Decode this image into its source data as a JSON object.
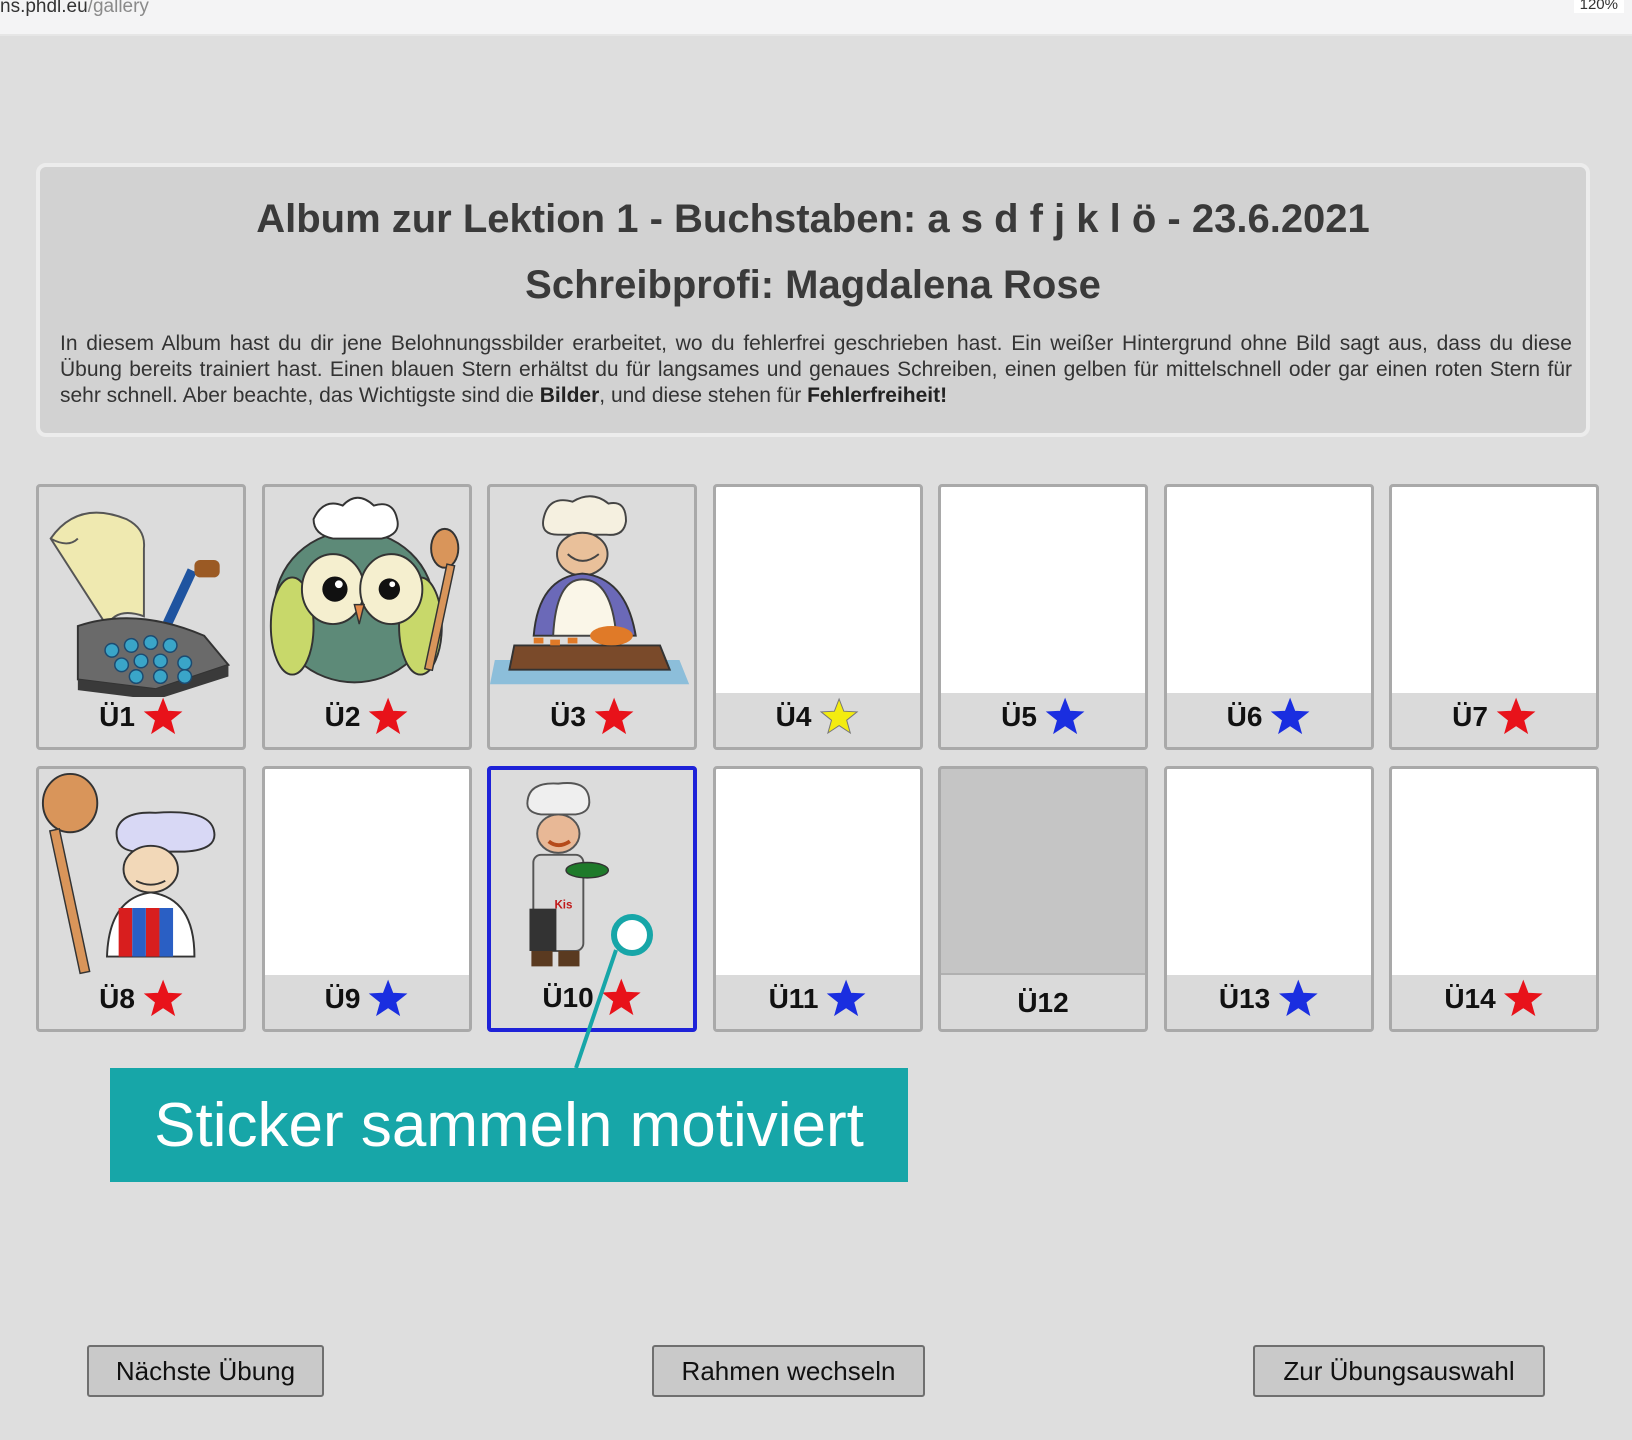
{
  "browser": {
    "url_host": "ns.phdl.eu",
    "url_path": "/gallery",
    "zoom": "120%"
  },
  "album": {
    "title": "Album zur Lektion 1 - Buchstaben: a s d f j k l ö - 23.6.2021",
    "subtitle": "Schreibprofi: Magdalena Rose",
    "intro_1": "In diesem Album hast du dir jene Belohnungssbilder erarbeitet, wo du fehlerfrei geschrieben hast. Ein weißer Hintergrund ohne Bild sagt aus, dass du diese Übung bereits trainiert hast. Einen blauen Stern erhältst du für langsames und genaues Schreiben, einen gelben für mittelschnell oder gar einen roten Stern für sehr schnell. Aber beachte, das Wichtigste sind die ",
    "intro_bold_1": "Bilder",
    "intro_2": ", und diese stehen für ",
    "intro_bold_2": "Fehlerfreiheit!"
  },
  "colors": {
    "red_star": "#e8121a",
    "blue_star": "#1a2ee0",
    "yellow_star": "#f4ec10",
    "selected_border": "#1e22d8",
    "callout": "#17a6a8"
  },
  "tiles": [
    {
      "label": "Ü1",
      "star": "red",
      "picture": "typewriter"
    },
    {
      "label": "Ü2",
      "star": "red",
      "picture": "owl-chef"
    },
    {
      "label": "Ü3",
      "star": "red",
      "picture": "chef-cutting"
    },
    {
      "label": "Ü4",
      "star": "yellow",
      "picture": ""
    },
    {
      "label": "Ü5",
      "star": "blue",
      "picture": ""
    },
    {
      "label": "Ü6",
      "star": "blue",
      "picture": ""
    },
    {
      "label": "Ü7",
      "star": "red",
      "picture": ""
    },
    {
      "label": "Ü8",
      "star": "red",
      "picture": "chef-spoon"
    },
    {
      "label": "Ü9",
      "star": "blue",
      "picture": ""
    },
    {
      "label": "Ü10",
      "star": "red",
      "picture": "chef-pan",
      "selected": true
    },
    {
      "label": "Ü11",
      "star": "blue",
      "picture": ""
    },
    {
      "label": "Ü12",
      "star": "",
      "picture": "",
      "untrained": true
    },
    {
      "label": "Ü13",
      "star": "blue",
      "picture": ""
    },
    {
      "label": "Ü14",
      "star": "red",
      "picture": ""
    }
  ],
  "callout": {
    "text": "Sticker sammeln motiviert"
  },
  "buttons": {
    "next": "Nächste Übung",
    "frame": "Rahmen wechseln",
    "selection": "Zur Übungsauswahl"
  }
}
